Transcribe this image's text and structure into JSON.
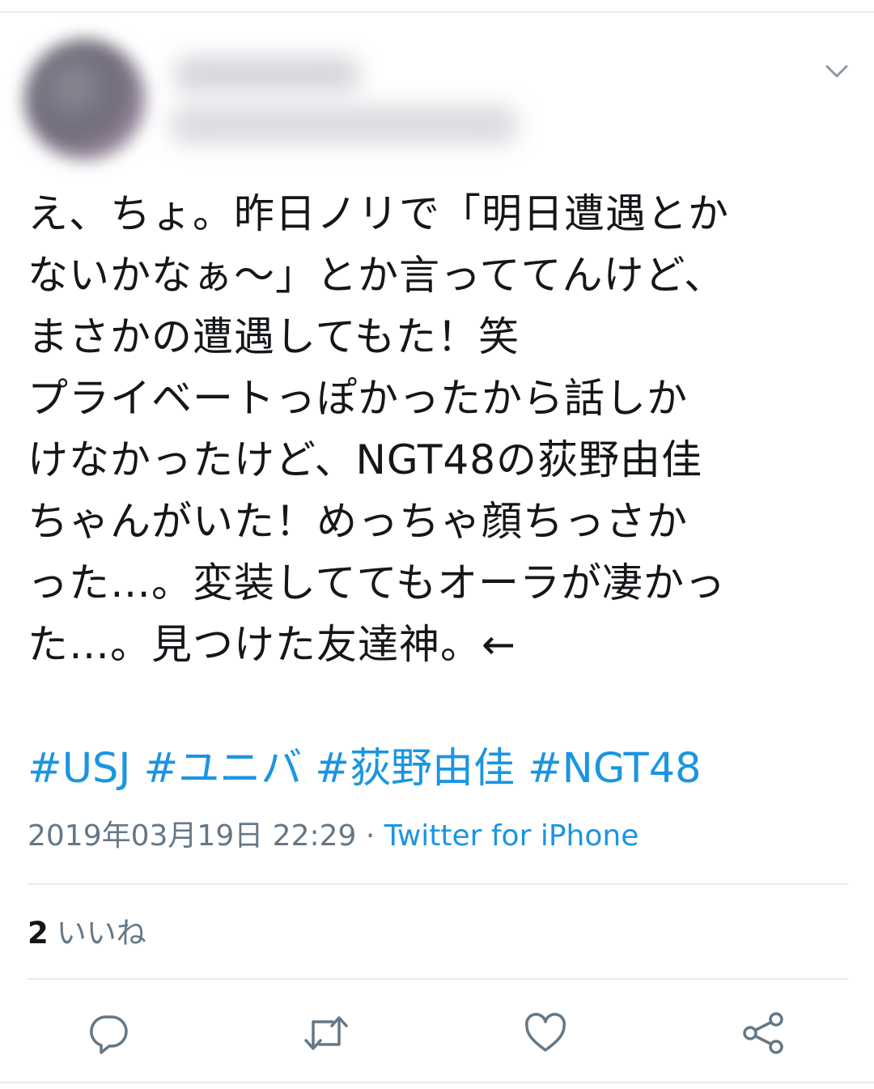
{
  "tweet": {
    "user": {
      "display_name": "",
      "handle": ""
    },
    "text": "え、ちょ。昨日ノリで「明日遭遇とか\nないかなぁ〜」とか言っててんけど、\nまさかの遭遇してもた！笑\nプライベートっぽかったから話しか\nけなかったけど、NGT48の荻野由佳\nちゃんがいた！めっちゃ顔ちっさか\nった…。変装しててもオーラが凄かっ\nた…。見つけた友達神。←",
    "hashtags": [
      "#USJ",
      "#ユニバ",
      "#荻野由佳",
      "#NGT48"
    ],
    "timestamp": "2019年03月19日 22:29",
    "separator": " · ",
    "source": "Twitter for iPhone",
    "likes": {
      "count": "2",
      "label": "いいね"
    }
  },
  "icons": {
    "more": "chevron-down-icon",
    "reply": "reply-icon",
    "retweet": "retweet-icon",
    "like": "heart-icon",
    "share": "share-icon"
  },
  "colors": {
    "link": "#1b95e0",
    "secondary_text": "#657786",
    "icon": "#657786",
    "divider": "#e6ecf0",
    "text": "#14171a"
  }
}
